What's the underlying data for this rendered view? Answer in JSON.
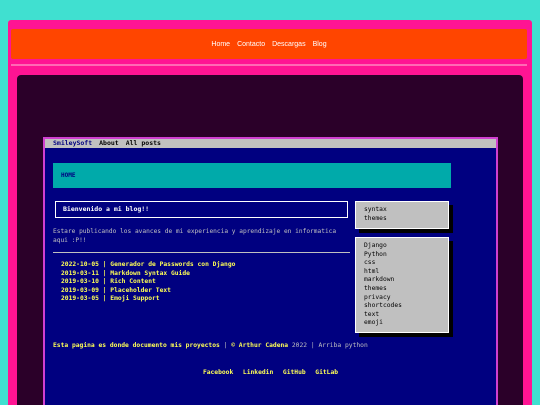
{
  "topnav": {
    "items": [
      "Home",
      "Contacto",
      "Descargas",
      "Blog"
    ]
  },
  "menubar": {
    "brand": "SmileySoft",
    "about": "About",
    "all_posts": "All posts"
  },
  "home_panel": {
    "label": "HOME"
  },
  "welcome": {
    "text": "Bienvenido a mi blog!!"
  },
  "intro": {
    "text": "Estare publicando los avances de mi experiencia y aprendizaje en informatica aqui :P!!"
  },
  "posts": [
    {
      "date": "2022-10-05",
      "title": "Generador de Passwords con Django"
    },
    {
      "date": "2019-03-11",
      "title": "Markdown Syntax Guide"
    },
    {
      "date": "2019-03-10",
      "title": "Rich Content"
    },
    {
      "date": "2019-03-09",
      "title": "Placeholder Text"
    },
    {
      "date": "2019-03-05",
      "title": "Emoji Support"
    }
  ],
  "categories": [
    "syntax",
    "themes"
  ],
  "tags": [
    "Django",
    "Python",
    "css",
    "html",
    "markdown",
    "themes",
    "privacy",
    "shortcodes",
    "text",
    "emoji"
  ],
  "footer": {
    "lead": "Esta pagina es donde documento mis proyectos",
    "sep1": "|",
    "copyright": "© Arthur Cadena",
    "year": "2022",
    "sep2": "|",
    "arriba": "Arriba",
    "python": "python"
  },
  "social": [
    "Facebook",
    "Linkedin",
    "GitHub",
    "GitLab"
  ]
}
